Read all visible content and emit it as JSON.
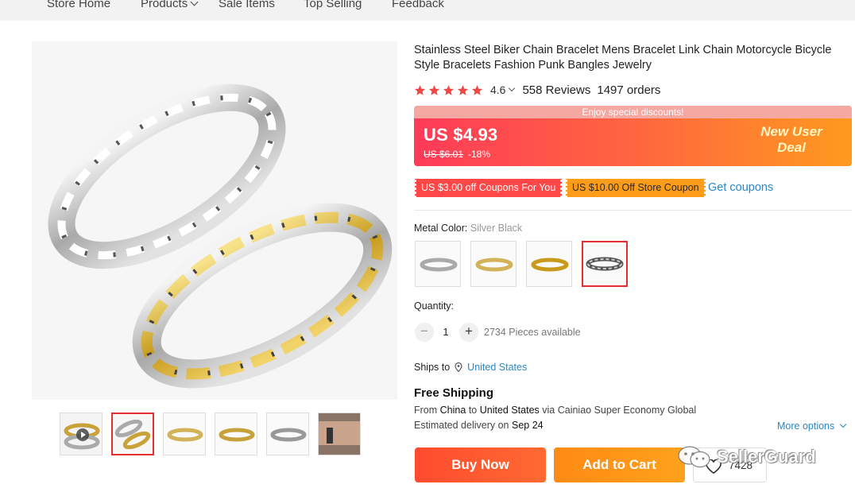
{
  "topnav": {
    "items": [
      "Store Home",
      "Products",
      "Sale Items",
      "Top Selling",
      "Feedback"
    ]
  },
  "product": {
    "title": "Stainless Steel Biker Chain Bracelet Mens Bracelet Link Chain Motorcycle Bicycle Style Bracelets Fashion Punk Bangles Jewelry",
    "rating": "4.6",
    "reviews": "558 Reviews",
    "orders": "1497 orders",
    "star_color": "#f04646"
  },
  "pricing": {
    "promo_banner": "Enjoy special discounts!",
    "price": "US $4.93",
    "original_price": "US $6.01",
    "discount": "-18%",
    "new_user_line1": "New User",
    "new_user_line2": "Deal"
  },
  "coupons": {
    "coupon1": "US $3.00 off Coupons For You",
    "coupon2": "US $10.00 Off Store Coupon",
    "get_coupons": "Get coupons"
  },
  "variant": {
    "label": "Metal Color:",
    "selected": "Silver Black",
    "options": [
      "silver",
      "silver-gold",
      "gold",
      "silver-black"
    ],
    "selected_index": 3
  },
  "quantity": {
    "label": "Quantity:",
    "value": "1",
    "available": "2734 Pieces available"
  },
  "shipping": {
    "ships_to_label": "Ships to",
    "ships_to_country": "United States",
    "free_shipping": "Free Shipping",
    "from_label": "From",
    "from_country": "China",
    "to_label": "to",
    "to_country": "United States",
    "via": "via Cainiao Super Economy Global",
    "estimated_label": "Estimated delivery on",
    "estimated_date": "Sep 24",
    "more_options": "More options"
  },
  "actions": {
    "buy_now": "Buy Now",
    "add_to_cart": "Add to Cart",
    "wishlist_count": "7428"
  },
  "watermark": {
    "text": "SellerGuard"
  },
  "gallery": {
    "thumbnail_count": 6,
    "active_thumbnail": 1
  }
}
